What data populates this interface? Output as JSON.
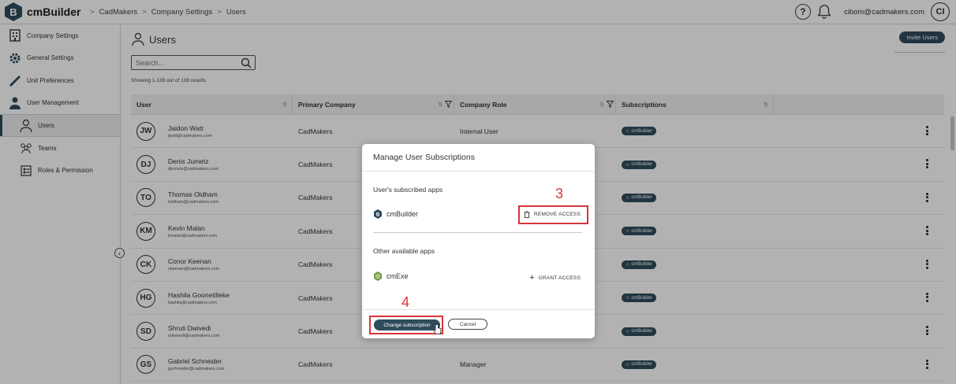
{
  "app": {
    "name": "cmBuilder",
    "logo_letter": "B"
  },
  "breadcrumb": [
    "CadMakers",
    "Company Settings",
    "Users"
  ],
  "header": {
    "email": "cibom@cadmakers.com",
    "avatar": "CI"
  },
  "sidebar": {
    "items": [
      {
        "label": "Company Settings",
        "icon": "building-icon"
      },
      {
        "label": "General Settings",
        "icon": "gear-icon"
      },
      {
        "label": "Unit Preferences",
        "icon": "ruler-icon"
      },
      {
        "label": "User Management",
        "icon": "user-icon"
      },
      {
        "label": "Users",
        "icon": "users-icon"
      },
      {
        "label": "Teams",
        "icon": "team-icon"
      },
      {
        "label": "Roles & Permission",
        "icon": "roles-icon"
      }
    ]
  },
  "page": {
    "title": "Users",
    "invite_label": "Invite Users",
    "search_placeholder": "Search...",
    "showing": "Showing 1-139 out of 139 results"
  },
  "table": {
    "columns": [
      "User",
      "Primary Company",
      "Company Role",
      "Subscriptions"
    ],
    "rows": [
      {
        "initials": "JW",
        "name": "Jaidon Watt",
        "email": "jwatt@cadmakers.com",
        "company": "CadMakers",
        "role": "Internal User",
        "sub": "cmBuilder"
      },
      {
        "initials": "DJ",
        "name": "Denis Jumetz",
        "email": "djumetz@cadmakers.com",
        "company": "CadMakers",
        "role": "",
        "sub": "cmBuilder"
      },
      {
        "initials": "TO",
        "name": "Thomas Oldham",
        "email": "toldham@cadmakers.com",
        "company": "CadMakers",
        "role": "",
        "sub": "cmBuilder"
      },
      {
        "initials": "KM",
        "name": "Kevin Malan",
        "email": "kmalan@cadmakers.com",
        "company": "CadMakers",
        "role": "",
        "sub": "cmBuilder"
      },
      {
        "initials": "CK",
        "name": "Conor Keenan",
        "email": "ckeenan@cadmakers.com",
        "company": "CadMakers",
        "role": "",
        "sub": "cmBuilder"
      },
      {
        "initials": "HG",
        "name": "Hashila Goonetilleke",
        "email": "hashila@cadmakers.com",
        "company": "CadMakers",
        "role": "",
        "sub": "cmBuilder"
      },
      {
        "initials": "SD",
        "name": "Shruti Dwivedi",
        "email": "sdwivedi@cadmakers.com",
        "company": "CadMakers",
        "role": "",
        "sub": "cmBuilder"
      },
      {
        "initials": "GS",
        "name": "Gabriel Schneider",
        "email": "gschneider@cadmakers.com",
        "company": "CadMakers",
        "role": "Manager",
        "sub": "cmBuilder"
      }
    ]
  },
  "modal": {
    "title": "Manage User Subscriptions",
    "subscribed_label": "User's subscribed apps",
    "subscribed_app": "cmBuilder",
    "remove_label": "REMOVE ACCESS",
    "available_label": "Other available apps",
    "available_app": "cmExe",
    "grant_label": "GRANT ACCESS",
    "change_label": "Change subscription",
    "cancel_label": "Cancel"
  },
  "annotations": {
    "step3": "3",
    "step4": "4"
  },
  "colors": {
    "primary": "#2e4c5c",
    "highlight": "#d9343a"
  }
}
